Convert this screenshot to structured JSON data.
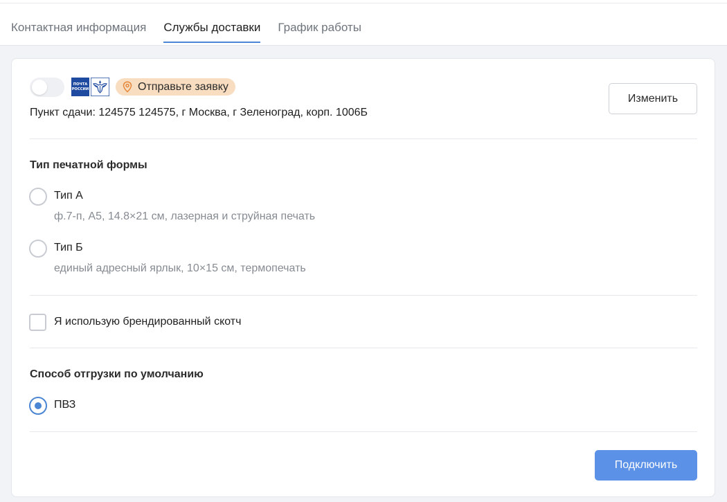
{
  "tabs": [
    {
      "label": "Контактная информация",
      "active": false
    },
    {
      "label": "Службы доставки",
      "active": true
    },
    {
      "label": "График работы",
      "active": false
    }
  ],
  "service": {
    "enabled": false,
    "logo_line1": "ПОЧТА",
    "logo_line2": "РОССИИ",
    "status_badge": "Отправьте заявку",
    "pickup_point": "Пункт сдачи: 124575 124575, г Москва, г Зеленоград, корп. 1006Б",
    "change_label": "Изменить"
  },
  "print_form": {
    "title": "Тип печатной формы",
    "options": [
      {
        "label": "Тип А",
        "description": "ф.7-п, А5, 14.8×21 см, лазерная и струйная печать",
        "selected": false
      },
      {
        "label": "Тип Б",
        "description": "единый адресный ярлык, 10×15 см, термопечать",
        "selected": false
      }
    ]
  },
  "branded_tape": {
    "label": "Я использую брендированный скотч",
    "checked": false
  },
  "shipment": {
    "title": "Способ отгрузки по умолчанию",
    "options": [
      {
        "label": "ПВЗ",
        "selected": true
      }
    ]
  },
  "connect_label": "Подключить",
  "colors": {
    "accent": "#4a86d4",
    "primary_button": "#5b91e6",
    "badge_bg": "#f8ddc0",
    "badge_icon": "#e5873a",
    "logo_blue": "#1e4aa0"
  },
  "icons": {
    "badge": "map-pin-icon",
    "logo": "russian-post-logo"
  }
}
